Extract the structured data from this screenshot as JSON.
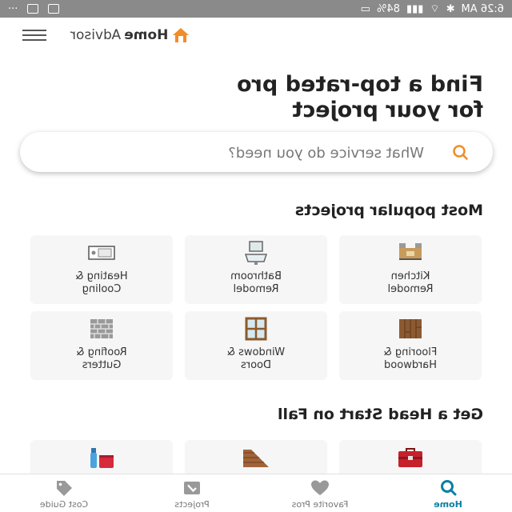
{
  "status_bar": {
    "time": "6:26 AM",
    "battery": "84%",
    "ellipsis": "···"
  },
  "header": {
    "logo_home": "Home",
    "logo_advisor": "Advisor"
  },
  "hero": {
    "line1": "Find a top-rated pro",
    "line2": "for your project"
  },
  "search": {
    "placeholder": "What service do you need?"
  },
  "popular": {
    "title": "Most popular projects",
    "items": [
      {
        "line1": "Kitchen",
        "line2": "Remodel",
        "icon": "kitchen-icon"
      },
      {
        "line1": "Bathroom",
        "line2": "Remodel",
        "icon": "bathroom-sink-icon"
      },
      {
        "line1": "Heating &",
        "line2": "Cooling",
        "icon": "thermostat-icon"
      },
      {
        "line1": "Flooring &",
        "line2": "Hardwood",
        "icon": "wood-floor-icon"
      },
      {
        "line1": "Windows &",
        "line2": "Doors",
        "icon": "window-icon"
      },
      {
        "line1": "Roofing &",
        "line2": "Gutters",
        "icon": "brick-wall-icon"
      }
    ]
  },
  "fall": {
    "title": "Get a Head Start on Fall",
    "items": [
      {
        "icon": "toolbox-icon"
      },
      {
        "icon": "roof-shingles-icon"
      },
      {
        "icon": "cleaning-supplies-icon"
      }
    ]
  },
  "tabs": [
    {
      "label": "Home",
      "icon": "search-icon",
      "active": true
    },
    {
      "label": "Favorite Pros",
      "icon": "heart-icon",
      "active": false
    },
    {
      "label": "Projects",
      "icon": "projects-icon",
      "active": false
    },
    {
      "label": "Cost Guide",
      "icon": "price-tag-icon",
      "active": false
    }
  ],
  "colors": {
    "accent_orange": "#f28c28",
    "active_tab_blue": "#0a7fa5",
    "status_bar_gray": "#8a8a8a",
    "card_background": "#f6f6f6"
  }
}
